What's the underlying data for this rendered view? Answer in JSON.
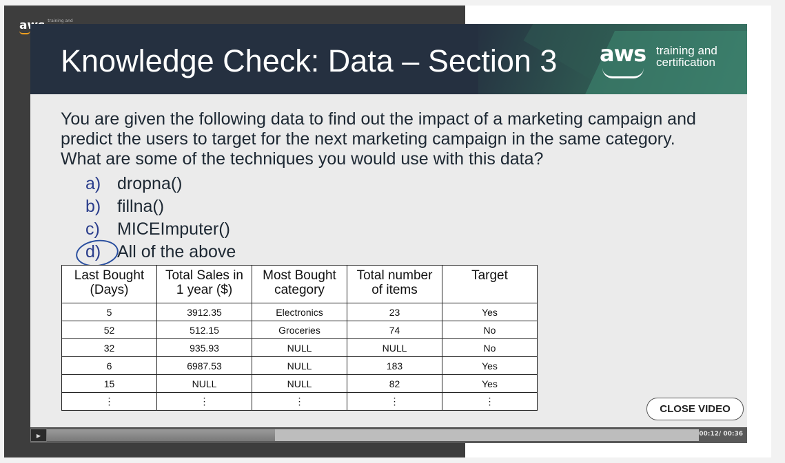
{
  "background_logo": {
    "text": "aws",
    "subtext": "training and"
  },
  "slide": {
    "title": "Knowledge Check: Data – Section 3",
    "logo": {
      "aws": "aws",
      "line1": "training and",
      "line2": "certification"
    },
    "question_part1": "You are given the following data to find out the impact of a marketing campaign and predict the users to target for the next marketing campaign in the same category. ",
    "question_part2": "What are some of the techniques you would use with this data?",
    "options": [
      {
        "letter": "a)",
        "text": "dropna()"
      },
      {
        "letter": "b)",
        "text": "fillna()"
      },
      {
        "letter": "c)",
        "text": "MICEImputer()"
      },
      {
        "letter": "d)",
        "text": "All of the above"
      }
    ],
    "table": {
      "headers": [
        [
          "Last Bought",
          "(Days)"
        ],
        [
          "Total Sales in",
          "1 year ($)"
        ],
        [
          "Most Bought",
          "category"
        ],
        [
          "Total number",
          "of items"
        ],
        [
          "Target",
          ""
        ]
      ],
      "rows": [
        [
          "5",
          "3912.35",
          "Electronics",
          "23",
          "Yes"
        ],
        [
          "52",
          "512.15",
          "Groceries",
          "74",
          "No"
        ],
        [
          "32",
          "935.93",
          "NULL",
          "NULL",
          "No"
        ],
        [
          "6",
          "6987.53",
          "NULL",
          "183",
          "Yes"
        ],
        [
          "15",
          "NULL",
          "NULL",
          "82",
          "Yes"
        ],
        [
          "⋮",
          "⋮",
          "⋮",
          "⋮",
          "⋮"
        ]
      ]
    }
  },
  "close_button": "CLOSE VIDEO",
  "player": {
    "play_icon": "play-icon",
    "progress": 0.35,
    "time": "00:12/ 00:36"
  },
  "colors": {
    "header_bg": "#253040",
    "option_letter": "#2b3e8c",
    "annotation_circle": "#2a4f9f"
  }
}
